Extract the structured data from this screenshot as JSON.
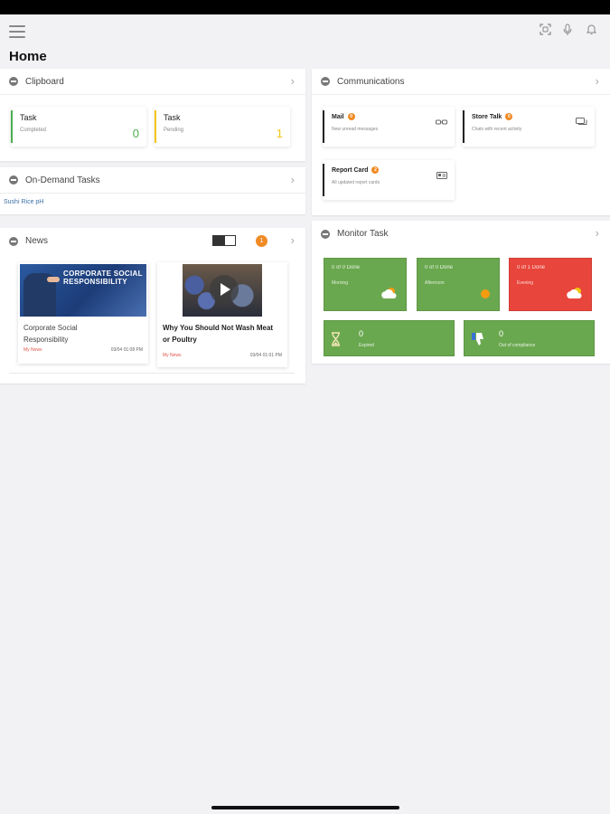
{
  "page": {
    "title": "Home"
  },
  "clipboard": {
    "title": "Clipboard",
    "tiles": [
      {
        "label": "Task",
        "sub": "Completed",
        "count": "0",
        "color": "#4caf50"
      },
      {
        "label": "Task",
        "sub": "Pending",
        "count": "1",
        "color": "#f5c518"
      }
    ]
  },
  "ondemand": {
    "title": "On-Demand Tasks",
    "item": "Sushi Rice pH"
  },
  "news": {
    "title": "News",
    "badge": "1",
    "items": [
      {
        "thumb_text": "CORPORATE SOCIAL RESPONSIBILITY",
        "title": "Corporate Social Responsibility",
        "source": "My News",
        "date": "03/04 01:08 PM"
      },
      {
        "title": "Why You Should Not Wash Meat or Poultry",
        "source": "My News",
        "date": "03/04 01:01 PM"
      }
    ]
  },
  "communications": {
    "title": "Communications",
    "tiles": [
      {
        "label": "Mail",
        "badge": "0",
        "sub": "New unread messages",
        "icon": "glasses-icon"
      },
      {
        "label": "Store Talk",
        "badge": "0",
        "sub": "Chats with recent activity",
        "icon": "chat-icon"
      },
      {
        "label": "Report Card",
        "badge": "2",
        "sub": "All updated report cards",
        "icon": "id-card-icon"
      }
    ]
  },
  "monitor": {
    "title": "Monitor Task",
    "tiles": [
      {
        "status": "0 of 0 Done",
        "period": "Morning",
        "color": "#6aa84f",
        "icon": "partly-cloudy-icon"
      },
      {
        "status": "0 of 0 Done",
        "period": "Afternoon",
        "color": "#6aa84f",
        "icon": "sun-icon"
      },
      {
        "status": "0 of 1 Done",
        "period": "Evening",
        "color": "#e8453c",
        "icon": "cloud-sun-icon"
      },
      {
        "count": "0",
        "label": "Expired",
        "color": "#6aa84f",
        "icon": "hourglass-icon"
      },
      {
        "count": "0",
        "label": "Out of compliance",
        "color": "#6aa84f",
        "icon": "thumbs-down-icon"
      }
    ]
  }
}
